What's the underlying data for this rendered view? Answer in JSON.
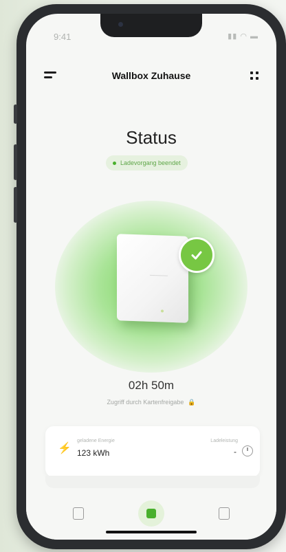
{
  "status_bar": {
    "time": "9:41"
  },
  "header": {
    "title": "Wallbox Zuhause"
  },
  "status": {
    "title": "Status",
    "badge": "Ladevorgang beendet",
    "duration": "02h 50m",
    "access": "Zugriff durch Kartenfreigabe"
  },
  "card": {
    "energy_label": "geladene Energie",
    "energy_value": "123 kWh",
    "power_label": "Ladeleistung",
    "power_value": "-"
  },
  "colors": {
    "accent": "#49b02d",
    "glow": "#7bd35d"
  },
  "icons": [
    "menu-icon",
    "grid-icon",
    "check-icon",
    "bolt-icon",
    "lock-icon",
    "clock-icon",
    "stats-icon",
    "charger-icon",
    "calendar-icon"
  ]
}
